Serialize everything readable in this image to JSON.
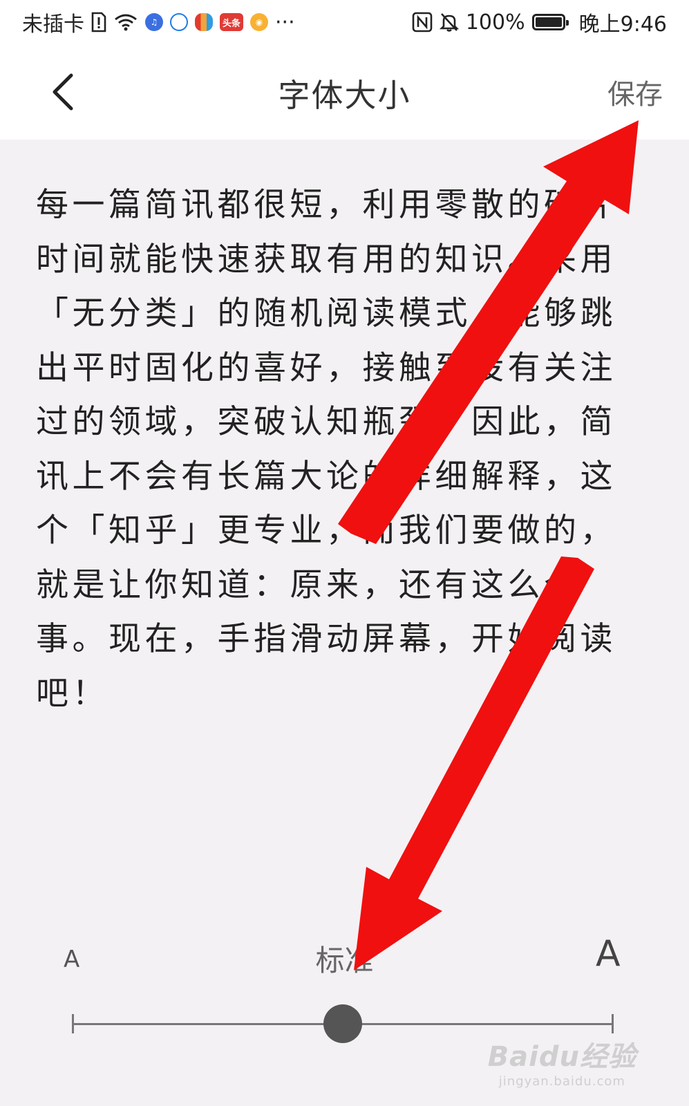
{
  "status_bar": {
    "carrier": "未插卡",
    "apps": [
      "music-app",
      "cloud-app",
      "color-app",
      "头条",
      "weibo-app"
    ],
    "more": "···",
    "battery": "100%",
    "battery_level": 1.0,
    "time": "晚上9:46"
  },
  "header": {
    "title": "字体大小",
    "save_label": "保存"
  },
  "preview": {
    "text": "每一篇简讯都很短，利用零散的碎片时间就能快速获取有用的知识。采用「无分类」的随机阅读模式，能够跳出平时固化的喜好，接触到没有关注过的领域，突破认知瓶颈。因此，简讯上不会有长篇大论的详细解释，这个「知乎」更专业，而我们要做的，就是让你知道：原来，还有这么个事。现在，手指滑动屏幕，开始阅读吧！"
  },
  "size_selector": {
    "small_label": "A",
    "current_label": "标准",
    "large_label": "A",
    "level": 0.5
  },
  "colors": {
    "arrow": "#f01010",
    "thumb": "#555555",
    "track": "#777777"
  },
  "watermark": {
    "logo": "Baidu经验",
    "sub": "jingyan.baidu.com"
  }
}
